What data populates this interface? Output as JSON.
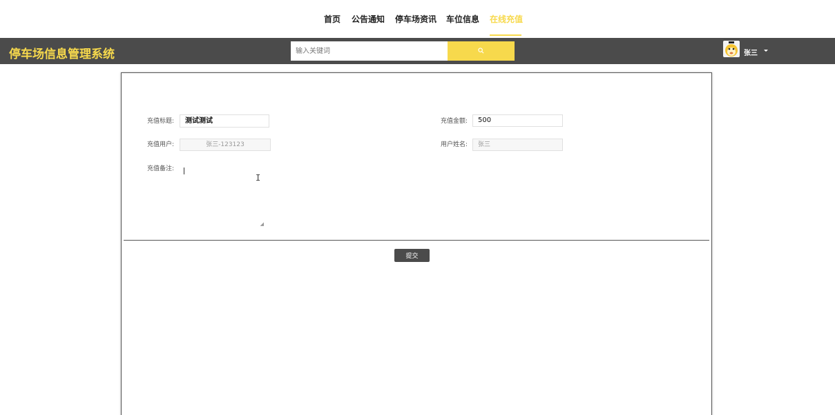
{
  "nav": {
    "items": [
      {
        "label": "首页"
      },
      {
        "label": "公告通知"
      },
      {
        "label": "停车场资讯"
      },
      {
        "label": "车位信息"
      },
      {
        "label": "在线充值",
        "active": true
      }
    ]
  },
  "header": {
    "brand": "停车场信息管理系统",
    "search_placeholder": "输入关键词",
    "search_icon": "search-icon",
    "user": {
      "name": "张三",
      "avatar_icon": "avatar-cartoon-icon",
      "menu_icon": "caret-down-icon"
    }
  },
  "form": {
    "title_label": "充值标题:",
    "title_value": "测试测试",
    "amount_label": "充值金额:",
    "amount_value": "500",
    "user_label": "充值用户:",
    "user_value": "张三-123123",
    "username_label": "用户姓名:",
    "username_value": "张三",
    "remark_label": "充值备注:",
    "remark_value": "",
    "submit_label": "提交"
  },
  "colors": {
    "accent": "#f7d94c",
    "header_bg": "#4b4b4b",
    "button_bg": "#4b4b4b"
  }
}
